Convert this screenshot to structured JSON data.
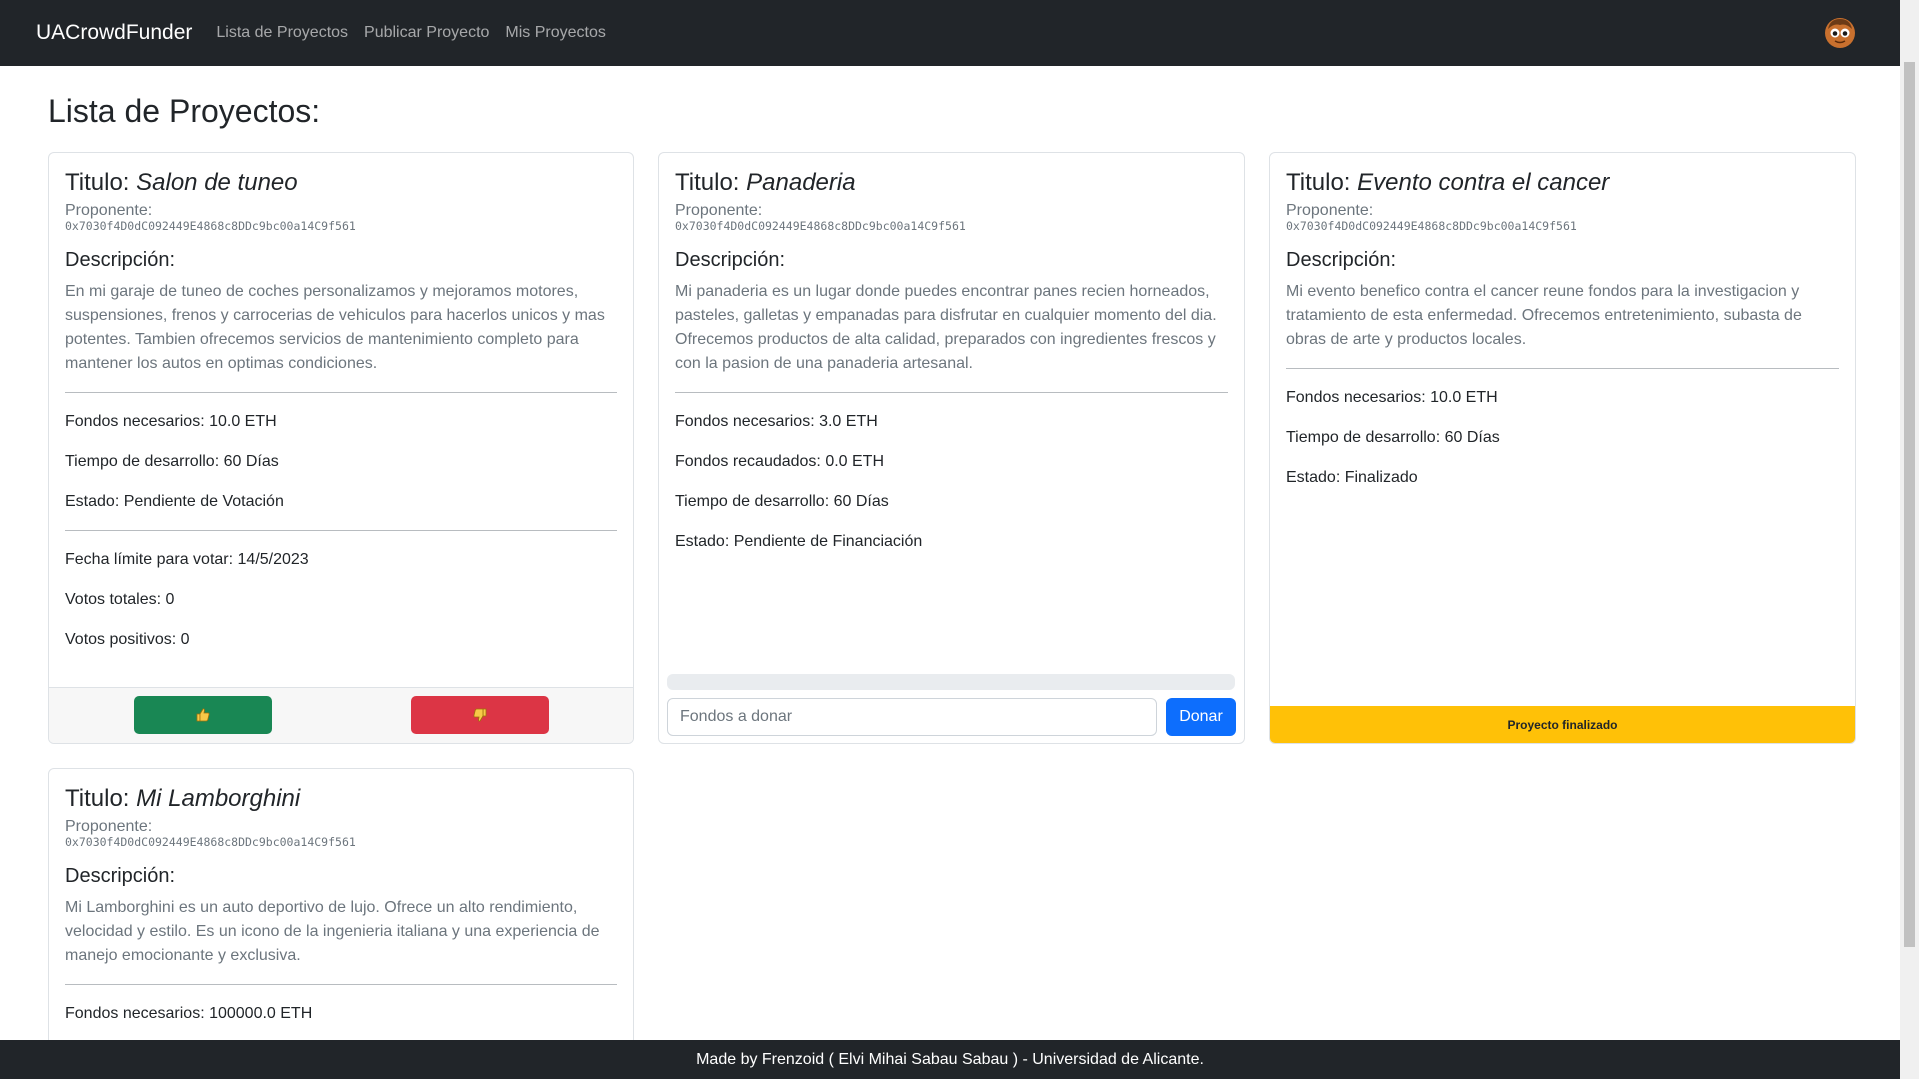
{
  "navbar": {
    "brand": "UACrowdFunder",
    "links": [
      "Lista de Proyectos",
      "Publicar Proyecto",
      "Mis Proyectos"
    ],
    "avatar_icon": "user-avatar-icon"
  },
  "page": {
    "title": "Lista de Proyectos:"
  },
  "labels": {
    "titulo": "Titulo:",
    "proponente": "Proponente:",
    "descripcion": "Descripción:"
  },
  "projects": [
    {
      "title": "Salon de tuneo",
      "proponent": "0x7030f4D0dC092449E4868c8DDc9bc00a14C9f561",
      "description": "En mi garaje de tuneo de coches personalizamos y mejoramos motores, suspensiones, frenos y carrocerias de vehiculos para hacerlos unicos y mas potentes. Tambien ofrecemos servicios de mantenimiento completo para mantener los autos en optimas condiciones.",
      "fondos_necesarios": "Fondos necesarios: 10.0 ETH",
      "tiempo": "Tiempo de desarrollo: 60 Días",
      "estado": "Estado: Pendiente de Votación",
      "fecha_limite": "Fecha límite para votar: 14/5/2023",
      "votos_totales": "Votos totales: 0",
      "votos_positivos": "Votos positivos: 0",
      "vote_up_icon": "thumbs-up-icon",
      "vote_down_icon": "thumbs-down-icon"
    },
    {
      "title": "Panaderia",
      "proponent": "0x7030f4D0dC092449E4868c8DDc9bc00a14C9f561",
      "description": "Mi panaderia es un lugar donde puedes encontrar panes recien horneados, pasteles, galletas y empanadas para disfrutar en cualquier momento del dia. Ofrecemos productos de alta calidad, preparados con ingredientes frescos y con la pasion de una panaderia artesanal.",
      "fondos_necesarios": "Fondos necesarios: 3.0 ETH",
      "fondos_recaudados": "Fondos recaudados: 0.0 ETH",
      "tiempo": "Tiempo de desarrollo: 60 Días",
      "estado": "Estado: Pendiente de Financiación",
      "progress_fraction": 0,
      "donate_placeholder": "Fondos a donar",
      "donate_button": "Donar"
    },
    {
      "title": "Evento contra el cancer",
      "proponent": "0x7030f4D0dC092449E4868c8DDc9bc00a14C9f561",
      "description": "Mi evento benefico contra el cancer reune fondos para la investigacion y tratamiento de esta enfermedad. Ofrecemos entretenimiento, subasta de obras de arte y productos locales.",
      "fondos_necesarios": "Fondos necesarios: 10.0 ETH",
      "tiempo": "Tiempo de desarrollo: 60 Días",
      "estado": "Estado: Finalizado",
      "finalized_label": "Proyecto finalizado"
    },
    {
      "title": "Mi Lamborghini",
      "proponent": "0x7030f4D0dC092449E4868c8DDc9bc00a14C9f561",
      "description": "Mi Lamborghini es un auto deportivo de lujo. Ofrece un alto rendimiento, velocidad y estilo. Es un icono de la ingenieria italiana y una experiencia de manejo emocionante y exclusiva.",
      "fondos_necesarios": "Fondos necesarios: 100000.0 ETH"
    }
  ],
  "footer": {
    "text": "Made by Frenzoid ( Elvi Mihai Sabau Sabau ) - Universidad de Alicante."
  },
  "colors": {
    "navbar": "#212529",
    "success": "#198754",
    "danger": "#dc3545",
    "primary": "#0d6efd",
    "warning": "#ffc107"
  }
}
